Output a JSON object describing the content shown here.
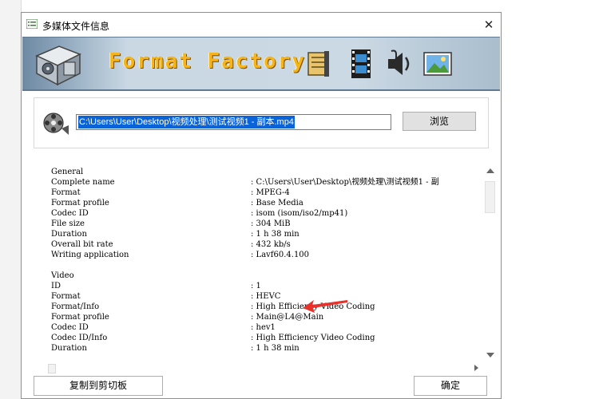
{
  "window": {
    "title": "多媒体文件信息",
    "close_glyph": "✕"
  },
  "banner": {
    "brand": "Format Factory",
    "icons": [
      "format-factory-logo-icon",
      "document-icon",
      "video-film-icon",
      "audio-speaker-icon",
      "picture-icon"
    ]
  },
  "file": {
    "path": "C:\\Users\\User\\Desktop\\视频处理\\测试视频1 - 副本.mp4",
    "browse_label": "浏览"
  },
  "info_rows": [
    {
      "key": "General",
      "value": ""
    },
    {
      "key": "Complete name",
      "value": ": C:\\Users\\User\\Desktop\\视频处理\\测试视频1 - 副"
    },
    {
      "key": "Format",
      "value": ": MPEG-4"
    },
    {
      "key": "Format profile",
      "value": ": Base Media"
    },
    {
      "key": "Codec ID",
      "value": ": isom (isom/iso2/mp41)"
    },
    {
      "key": "File size",
      "value": ": 304 MiB"
    },
    {
      "key": "Duration",
      "value": ": 1 h 38 min"
    },
    {
      "key": "Overall bit rate",
      "value": ": 432 kb/s"
    },
    {
      "key": "Writing application",
      "value": ": Lavf60.4.100"
    },
    {
      "key": "",
      "value": ""
    },
    {
      "key": "Video",
      "value": ""
    },
    {
      "key": "ID",
      "value": ": 1"
    },
    {
      "key": "Format",
      "value": ": HEVC"
    },
    {
      "key": "Format/Info",
      "value": ": High Efficiency Video Coding"
    },
    {
      "key": "Format profile",
      "value": ": Main@L4@Main"
    },
    {
      "key": "Codec ID",
      "value": ": hev1"
    },
    {
      "key": "Codec ID/Info",
      "value": ": High Efficiency Video Coding"
    },
    {
      "key": "Duration",
      "value": ": 1 h 38 min"
    }
  ],
  "buttons": {
    "copy_label": "复制到剪切板",
    "ok_label": "确定"
  },
  "colors": {
    "selection": "#0a64d8",
    "brand_text": "#f6b41a",
    "annotation_arrow": "#e8312a"
  }
}
